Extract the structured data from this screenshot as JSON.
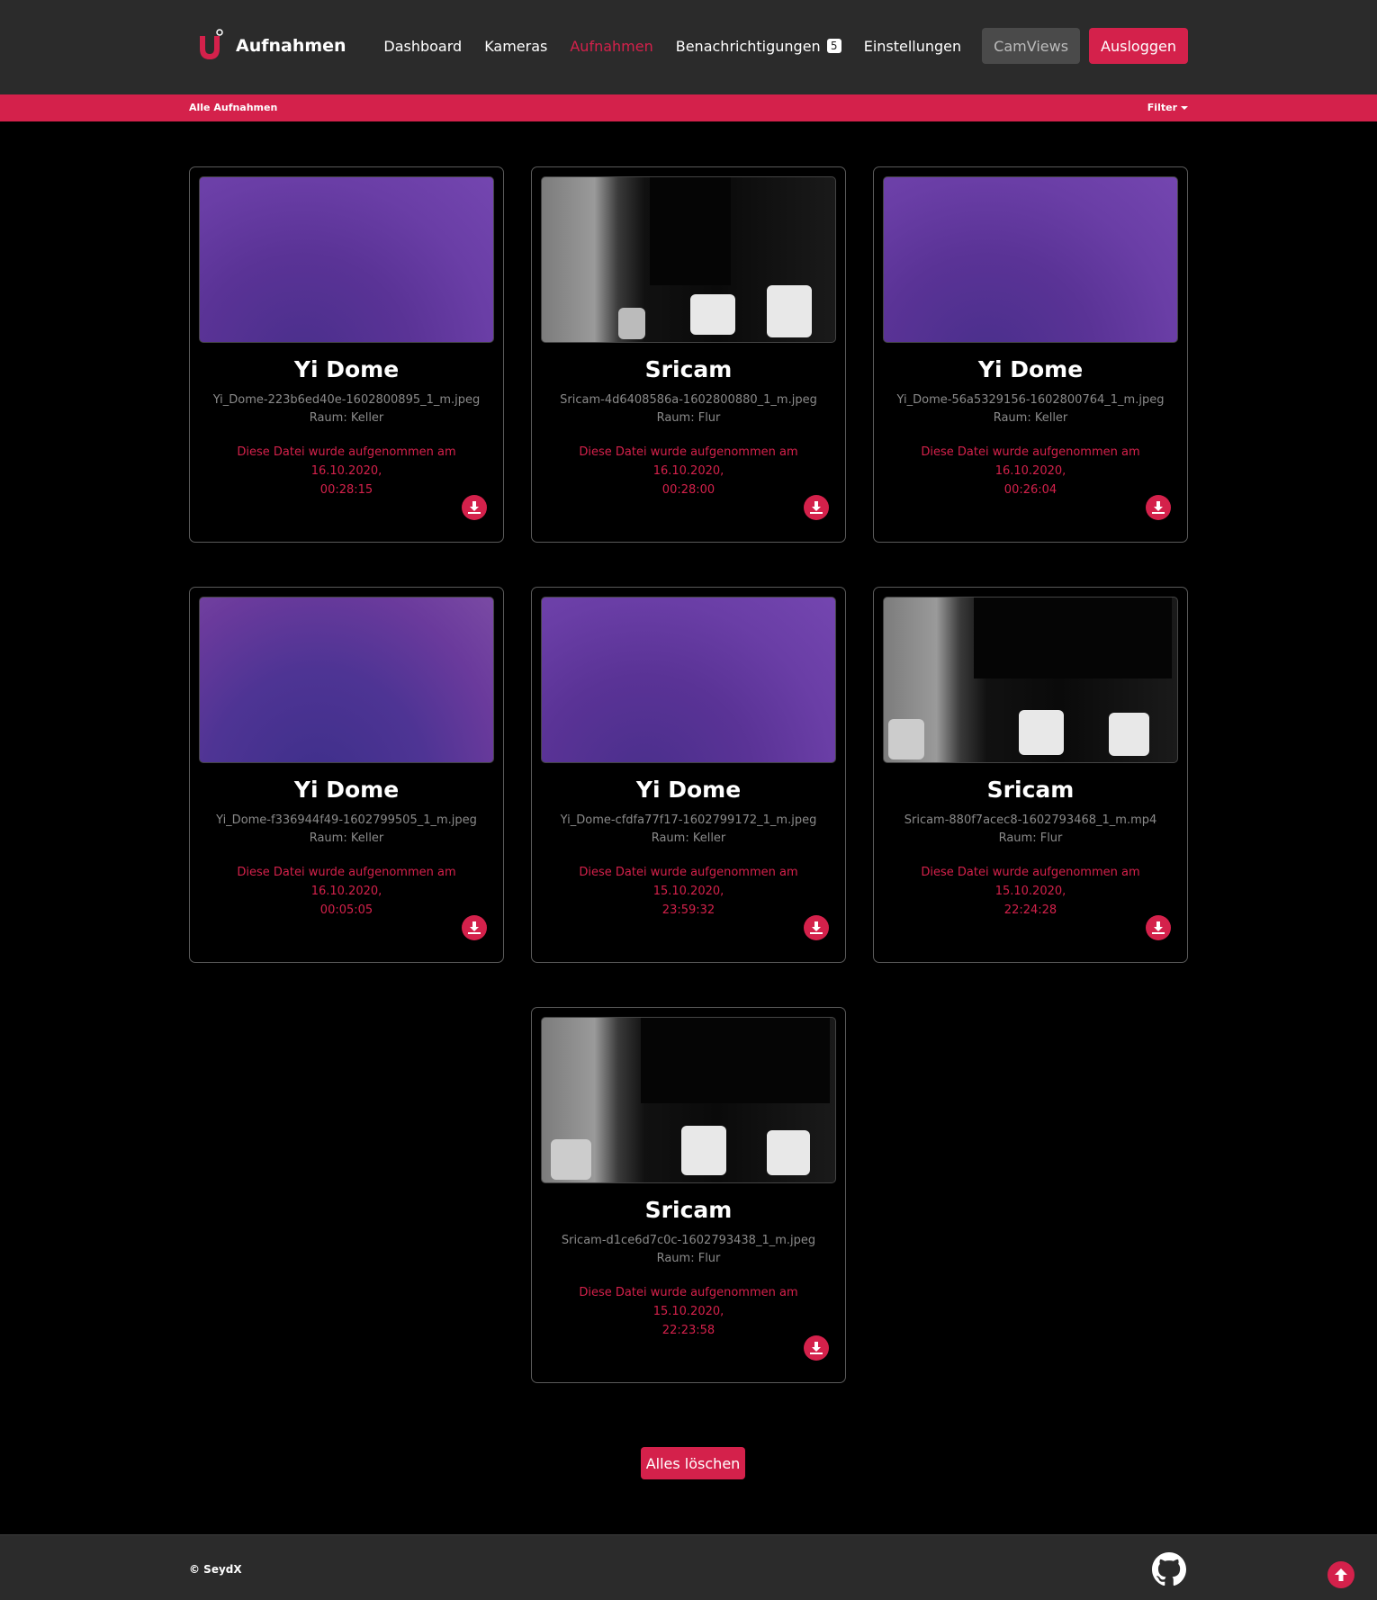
{
  "app": {
    "title": "Aufnahmen"
  },
  "nav": {
    "items": [
      {
        "label": "Dashboard"
      },
      {
        "label": "Kameras"
      },
      {
        "label": "Aufnahmen"
      },
      {
        "label": "Benachrichtigungen"
      },
      {
        "label": "Einstellungen"
      }
    ],
    "notification_count": "5",
    "camviews_label": "CamViews",
    "logout_label": "Ausloggen"
  },
  "subbar": {
    "title": "Alle Aufnahmen",
    "filter_label": "Filter"
  },
  "recordings": [
    {
      "camera": "Yi Dome",
      "file": "Yi_Dome-223b6ed40e-1602800895_1_m.jpeg",
      "room": "Raum: Keller",
      "date_line1": "Diese Datei wurde aufgenommen am 16.10.2020,",
      "date_line2": "00:28:15",
      "thumb": "purple"
    },
    {
      "camera": "Sricam",
      "file": "Sricam-4d6408586a-1602800880_1_m.jpeg",
      "room": "Raum: Flur",
      "date_line1": "Diese Datei wurde aufgenommen am 16.10.2020,",
      "date_line2": "00:28:00",
      "thumb": "cam"
    },
    {
      "camera": "Yi Dome",
      "file": "Yi_Dome-56a5329156-1602800764_1_m.jpeg",
      "room": "Raum: Keller",
      "date_line1": "Diese Datei wurde aufgenommen am 16.10.2020,",
      "date_line2": "00:26:04",
      "thumb": "purple"
    },
    {
      "camera": "Yi Dome",
      "file": "Yi_Dome-f336944f49-1602799505_1_m.jpeg",
      "room": "Raum: Keller",
      "date_line1": "Diese Datei wurde aufgenommen am 16.10.2020,",
      "date_line2": "00:05:05",
      "thumb": "purple2"
    },
    {
      "camera": "Yi Dome",
      "file": "Yi_Dome-cfdfa77f17-1602799172_1_m.jpeg",
      "room": "Raum: Keller",
      "date_line1": "Diese Datei wurde aufgenommen am 15.10.2020,",
      "date_line2": "23:59:32",
      "thumb": "purple"
    },
    {
      "camera": "Sricam",
      "file": "Sricam-880f7acec8-1602793468_1_m.mp4",
      "room": "Raum: Flur",
      "date_line1": "Diese Datei wurde aufgenommen am 15.10.2020,",
      "date_line2": "22:24:28",
      "thumb": "cam"
    },
    {
      "camera": "Sricam",
      "file": "Sricam-d1ce6d7c0c-1602793438_1_m.jpeg",
      "room": "Raum: Flur",
      "date_line1": "Diese Datei wurde aufgenommen am 15.10.2020,",
      "date_line2": "22:23:58",
      "thumb": "cam"
    }
  ],
  "actions": {
    "delete_all_label": "Alles löschen"
  },
  "footer": {
    "copyright": "© SeydX"
  },
  "colors": {
    "accent": "#d4214b",
    "navbar": "#2b2b2b",
    "background": "#000000"
  },
  "icons": {
    "logo": "u-magnet-logo-icon",
    "download": "download-icon",
    "github": "github-icon",
    "scroll_top": "arrow-up-icon"
  }
}
